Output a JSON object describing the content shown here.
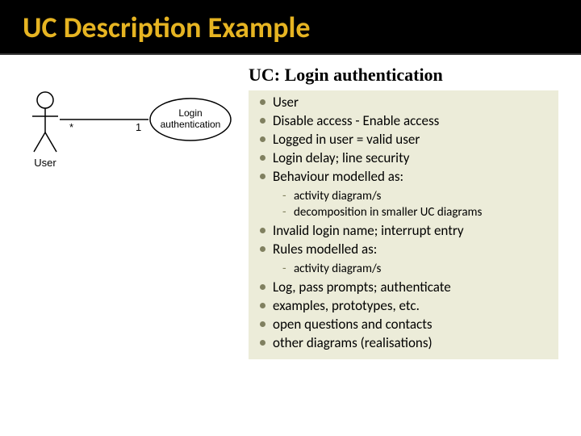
{
  "title": "UC Description Example",
  "uc_title": "UC: Login authentication",
  "diagram": {
    "actor_label": "User",
    "star": "*",
    "mult": "1",
    "uc_label1": "Login",
    "uc_label2": "authentication"
  },
  "bullets": [
    {
      "text": "User"
    },
    {
      "text": "Disable access - Enable access"
    },
    {
      "text": "Logged in user = valid user"
    },
    {
      "text": "Login delay; line security"
    },
    {
      "text": "Behaviour modelled as:",
      "sub": [
        "activity diagram/s",
        "decomposition in smaller UC diagrams"
      ]
    },
    {
      "text": "Invalid login name; interrupt entry"
    },
    {
      "text": "Rules modelled as:",
      "sub": [
        "activity diagram/s"
      ]
    },
    {
      "text": "Log, pass prompts; authenticate"
    },
    {
      "text": "examples, prototypes, etc."
    },
    {
      "text": "open questions and contacts"
    },
    {
      "text": "other diagrams (realisations)"
    }
  ]
}
